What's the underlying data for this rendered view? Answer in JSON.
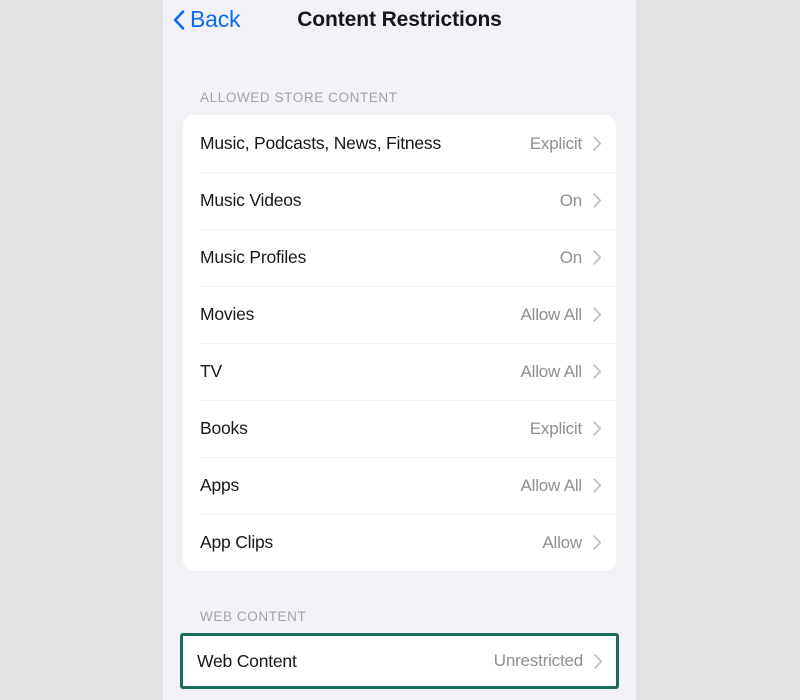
{
  "colors": {
    "outer_background": "#e2e2e2",
    "page_background": "#f2f1f5",
    "card_background": "#ffffff",
    "accent_blue": "#0a6cf5",
    "highlight_green": "#1c6b5d",
    "value_gray": "#8e8e93",
    "header_gray": "#a2a2a8",
    "label_black": "#18181c"
  },
  "navbar": {
    "back_label": "Back",
    "back_icon": "chevron-left-icon",
    "title": "Content Restrictions"
  },
  "sections": [
    {
      "id": "allowed-store-content",
      "header": "ALLOWED STORE CONTENT",
      "highlighted": false,
      "rows": [
        {
          "label": "Music, Podcasts, News, Fitness",
          "value": "Explicit",
          "icon": "chevron-right-icon"
        },
        {
          "label": "Music Videos",
          "value": "On",
          "icon": "chevron-right-icon"
        },
        {
          "label": "Music Profiles",
          "value": "On",
          "icon": "chevron-right-icon"
        },
        {
          "label": "Movies",
          "value": "Allow All",
          "icon": "chevron-right-icon"
        },
        {
          "label": "TV",
          "value": "Allow All",
          "icon": "chevron-right-icon"
        },
        {
          "label": "Books",
          "value": "Explicit",
          "icon": "chevron-right-icon"
        },
        {
          "label": "Apps",
          "value": "Allow All",
          "icon": "chevron-right-icon"
        },
        {
          "label": "App Clips",
          "value": "Allow",
          "icon": "chevron-right-icon"
        }
      ]
    },
    {
      "id": "web-content",
      "header": "WEB CONTENT",
      "highlighted": true,
      "rows": [
        {
          "label": "Web Content",
          "value": "Unrestricted",
          "icon": "chevron-right-icon"
        }
      ]
    }
  ]
}
